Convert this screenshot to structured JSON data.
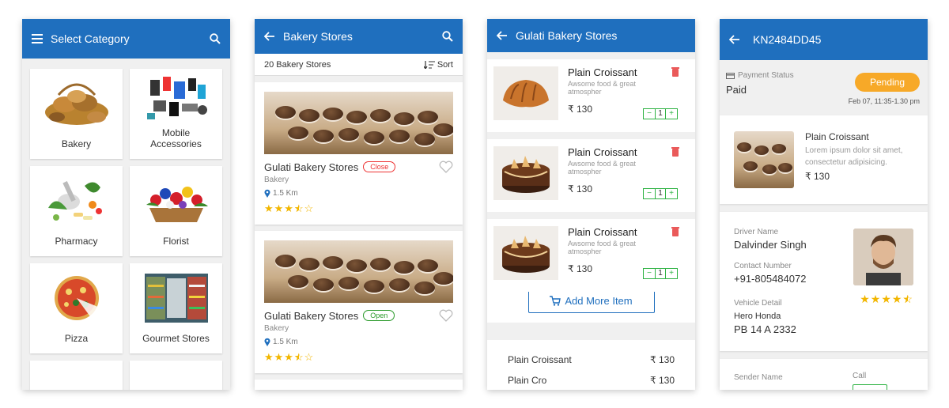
{
  "screen1": {
    "title": "Select Category",
    "categories": [
      {
        "label": "Bakery"
      },
      {
        "label": "Mobile\nAccessories"
      },
      {
        "label": "Pharmacy"
      },
      {
        "label": "Florist"
      },
      {
        "label": "Pizza"
      },
      {
        "label": "Gourmet Stores"
      }
    ]
  },
  "screen2": {
    "title": "Bakery Stores",
    "count": "20 Bakery Stores",
    "sort_label": "Sort",
    "stores": [
      {
        "name": "Gulati Bakery Stores",
        "status": "Close",
        "category": "Bakery",
        "distance": "1.5 Km",
        "rating": 3.5
      },
      {
        "name": "Gulati Bakery Stores",
        "status": "Open",
        "category": "Bakery",
        "distance": "1.5 Km",
        "rating": 3.5
      }
    ]
  },
  "screen3": {
    "title": "Gulati Bakery Stores",
    "items": [
      {
        "name": "Plain Croissant",
        "desc": "Awsome food & great atmospher",
        "price": "₹ 130",
        "qty": "1"
      },
      {
        "name": "Plain Croissant",
        "desc": "Awsome food & great atmospher",
        "price": "₹ 130",
        "qty": "1"
      },
      {
        "name": "Plain Croissant",
        "desc": "Awsome food & great atmospher",
        "price": "₹ 130",
        "qty": "1"
      }
    ],
    "add_more_label": "Add More Item",
    "summary": [
      {
        "name": "Plain Croissant",
        "price": "₹ 130"
      },
      {
        "name": "Plain Cro",
        "price": "₹ 130"
      }
    ]
  },
  "screen4": {
    "title": "KN2484DD45",
    "payment_label": "Payment Status",
    "payment_value": "Paid",
    "status_badge": "Pending",
    "datetime": "Feb 07, 11:35-1.30 pm",
    "product": {
      "name": "Plain Croissant",
      "desc": "Lorem ipsum dolor sit amet, consectetur adipisicing.",
      "price": "₹ 130"
    },
    "driver_label": "Driver Name",
    "driver_name": "Dalvinder Singh",
    "contact_label": "Contact Number",
    "contact": "+91-805484072",
    "vehicle_label": "Vehicle Detail",
    "vehicle_line1": "Hero Honda",
    "vehicle_line2": "PB 14 A 2332",
    "driver_rating": 4.5,
    "sender_label": "Sender Name",
    "call_label": "Call"
  },
  "colors": {
    "primary": "#1f6fbe",
    "pending": "#f7a928",
    "star": "#f2b600",
    "open": "#2a9a2a",
    "close": "#e33333"
  }
}
